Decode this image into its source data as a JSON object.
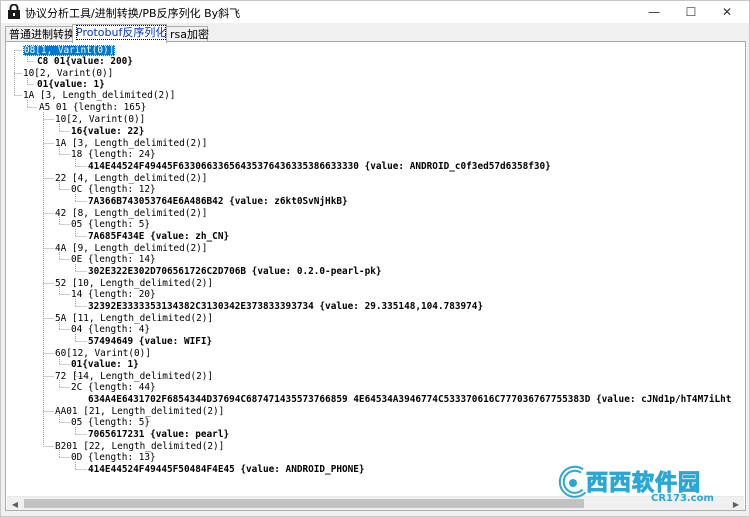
{
  "window": {
    "title": "协议分析工具/进制转换/PB反序列化  By斜飞",
    "buttons": {
      "minimize": "—",
      "maximize": "☐",
      "close": "✕"
    }
  },
  "tabs": [
    {
      "label": "普通进制转换",
      "active": false
    },
    {
      "label": "Protobuf反序列化",
      "active": true
    },
    {
      "label": "rsa加密",
      "active": false
    }
  ],
  "tree": [
    {
      "text": "08[1, Varint(0)]",
      "selected": true,
      "bold": false
    },
    {
      "text": "C8 01{value: 200}",
      "bold": true
    },
    {
      "text": "10[2, Varint(0)]",
      "bold": false
    },
    {
      "text": "01{value: 1}",
      "bold": true
    },
    {
      "text": "1A [3, Length_delimited(2)]",
      "bold": false
    },
    {
      "text": "A5 01 {length: 165}",
      "bold": false
    },
    {
      "text": "10[2, Varint(0)]",
      "bold": false
    },
    {
      "text": "16{value: 22}",
      "bold": true
    },
    {
      "text": "1A [3, Length_delimited(2)]",
      "bold": false
    },
    {
      "text": "18 {length: 24}",
      "bold": false
    },
    {
      "text": "414E44524F49445F63306633656435376436335386633330 {value: ANDROID_c0f3ed57d6358f30}",
      "bold": true
    },
    {
      "text": "22 [4, Length_delimited(2)]",
      "bold": false
    },
    {
      "text": "0C {length: 12}",
      "bold": false
    },
    {
      "text": "7A366B743053764E6A486B42 {value: z6kt0SvNjHkB}",
      "bold": true
    },
    {
      "text": "42 [8, Length_delimited(2)]",
      "bold": false
    },
    {
      "text": "05 {length: 5}",
      "bold": false
    },
    {
      "text": "7A685F434E {value: zh_CN}",
      "bold": true
    },
    {
      "text": "4A [9, Length_delimited(2)]",
      "bold": false
    },
    {
      "text": "0E {length: 14}",
      "bold": false
    },
    {
      "text": "302E322E302D706561726C2D706B {value: 0.2.0-pearl-pk}",
      "bold": true
    },
    {
      "text": "52 [10, Length_delimited(2)]",
      "bold": false
    },
    {
      "text": "14 {length: 20}",
      "bold": false
    },
    {
      "text": "32392E3333353134382C3130342E373833393734 {value: 29.335148,104.783974}",
      "bold": true
    },
    {
      "text": "5A [11, Length_delimited(2)]",
      "bold": false
    },
    {
      "text": "04 {length: 4}",
      "bold": false
    },
    {
      "text": "57494649 {value: WIFI}",
      "bold": true
    },
    {
      "text": "60[12, Varint(0)]",
      "bold": false
    },
    {
      "text": "01{value: 1}",
      "bold": true
    },
    {
      "text": "72 [14, Length_delimited(2)]",
      "bold": false
    },
    {
      "text": "2C {length: 44}",
      "bold": false
    },
    {
      "text": "634A4E6431702F6854344D37694C687471435573766859 4E64534A3946774C533370616C777036767755383D {value: cJNd1p/hT4M7iLht",
      "bold": true
    },
    {
      "text": "AA01 [21, Length_delimited(2)]",
      "bold": false
    },
    {
      "text": "05 {length: 5}",
      "bold": false
    },
    {
      "text": "7065617231 {value: pearl}",
      "bold": true
    },
    {
      "text": "B201 [22, Length_delimited(2)]",
      "bold": false
    },
    {
      "text": "0D {length: 13}",
      "bold": false
    },
    {
      "text": "414E44524F49445F50484F4E45 {value: ANDROID_PHONE}",
      "bold": true
    }
  ],
  "watermark": {
    "logo_text": "西西软件园",
    "url_text": "CR173.com"
  },
  "icons": {
    "app": "lock-app-icon",
    "scroll_left": "arrow-left-icon",
    "scroll_right": "arrow-right-icon"
  },
  "colors": {
    "selection": "#0078d7",
    "tree_line": "#a0a0a0",
    "watermark": "#2aa7d6"
  }
}
